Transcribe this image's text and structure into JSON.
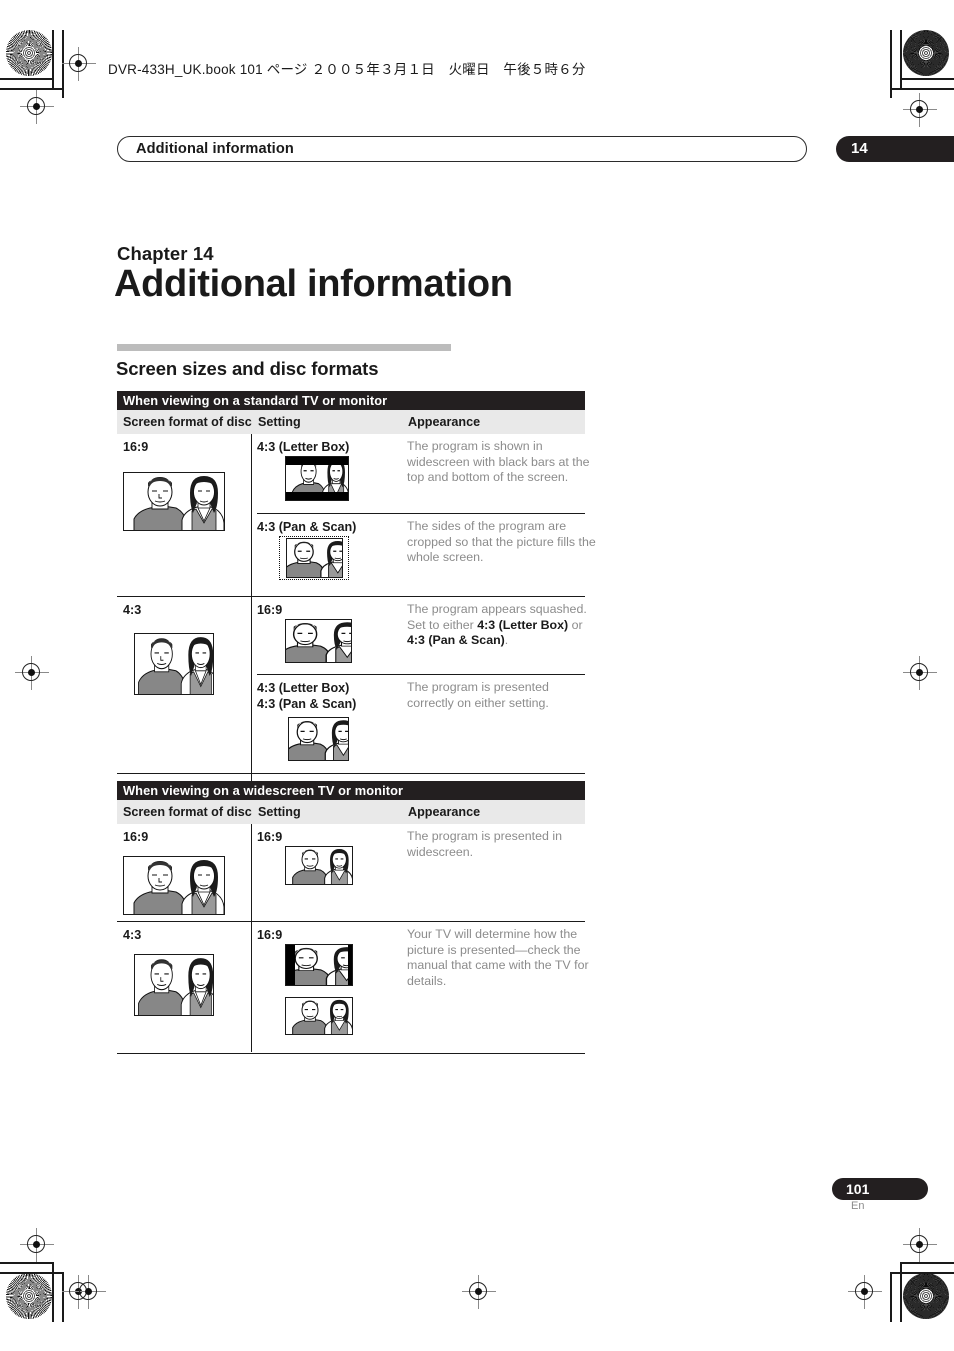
{
  "print_marks": {
    "book_line": "DVR-433H_UK.book  101 ページ  ２００５年３月１日　火曜日　午後５時６分"
  },
  "header": {
    "running_title": "Additional information",
    "chapter_tab": "14"
  },
  "chapter": {
    "label": "Chapter 14",
    "title": "Additional information"
  },
  "section": {
    "title": "Screen sizes and disc formats"
  },
  "columns": {
    "format": "Screen format of disc",
    "setting": "Setting",
    "appearance": "Appearance"
  },
  "tables": [
    {
      "banner": "When viewing on a standard TV or monitor",
      "rows": [
        {
          "format": "16:9",
          "format_pic": "16x9-wide",
          "settings": [
            {
              "setting": "4:3 (Letter Box)",
              "appearance": "The program is shown in widescreen with black bars at the top and bottom of the screen.",
              "pic": "letterbox"
            },
            {
              "setting": "4:3 (Pan & Scan)",
              "appearance": "The sides of the program are cropped so that the picture fills the whole screen.",
              "pic": "panscan"
            }
          ]
        },
        {
          "format": "4:3",
          "format_pic": "4x3-normal",
          "settings": [
            {
              "setting": "16:9",
              "appearance_html": "The program appears squashed. Set to either <b>4:3 (Letter Box)</b> or <b>4:3 (Pan &amp; Scan)</b>.",
              "appearance": "The program appears squashed. Set to either 4:3 (Letter Box) or 4:3 (Pan & Scan).",
              "pic": "squashed"
            },
            {
              "setting": "4:3 (Letter Box)\n4:3 (Pan & Scan)",
              "setting_line1": "4:3 (Letter Box)",
              "setting_line2": "4:3 (Pan & Scan)",
              "appearance": "The program is presented correctly on either setting.",
              "pic": "normal-small"
            }
          ]
        }
      ]
    },
    {
      "banner": "When viewing on a widescreen TV or monitor",
      "rows": [
        {
          "format": "16:9",
          "format_pic": "16x9-wide",
          "settings": [
            {
              "setting": "16:9",
              "appearance": "The program is presented in widescreen.",
              "pic": "wide-small"
            }
          ]
        },
        {
          "format": "4:3",
          "format_pic": "4x3-normal",
          "settings": [
            {
              "setting": "16:9",
              "appearance": "Your TV will determine how the picture is presented—check the manual that came with the TV for details.",
              "pic": "pillarbox-and-wide"
            }
          ]
        }
      ]
    }
  ],
  "footer": {
    "page_number": "101",
    "language": "En"
  }
}
